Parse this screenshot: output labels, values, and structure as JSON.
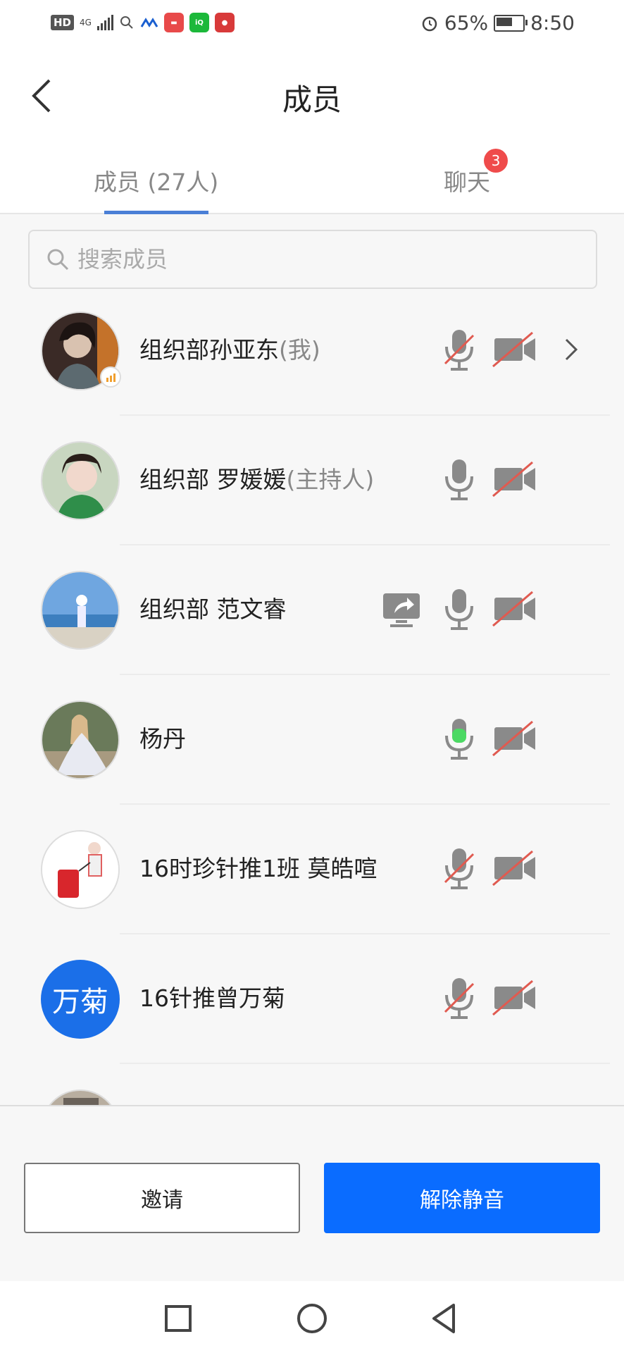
{
  "statusbar": {
    "hd": "HD",
    "network": "4G",
    "battery_pct": "65%",
    "time": "8:50"
  },
  "header": {
    "title": "成员"
  },
  "tabs": {
    "members_label": "成员 (27人)",
    "chat_label": "聊天",
    "chat_badge": "3",
    "active": "members"
  },
  "search": {
    "placeholder": "搜索成员"
  },
  "members": [
    {
      "name": "组织部孙亚东",
      "role": "(我)",
      "avatar": "photo",
      "mic": "muted",
      "camera": "off",
      "has_detail": true,
      "speaking_indicator": true
    },
    {
      "name": "组织部  罗媛媛",
      "role": "(主持人)",
      "avatar": "photo",
      "mic": "on",
      "camera": "off"
    },
    {
      "name": "组织部 范文睿",
      "role": "",
      "avatar": "photo",
      "mic": "on",
      "camera": "off",
      "screen_share": true
    },
    {
      "name": "杨丹",
      "role": "",
      "avatar": "photo",
      "mic": "speaking",
      "camera": "off"
    },
    {
      "name": "16时珍针推1班 莫皓喧",
      "role": "",
      "avatar": "photo",
      "mic": "muted",
      "camera": "off"
    },
    {
      "name": "16针推曾万菊",
      "role": "",
      "avatar_text": "万菊",
      "mic": "muted",
      "camera": "off"
    }
  ],
  "footer": {
    "invite_label": "邀请",
    "unmute_label": "解除静音"
  },
  "colors": {
    "accent": "#0a6cff",
    "tab_underline": "#4a7fd6",
    "badge": "#ef4b4b",
    "mute_slash": "#e05a50",
    "speaking_green": "#4cd964"
  }
}
